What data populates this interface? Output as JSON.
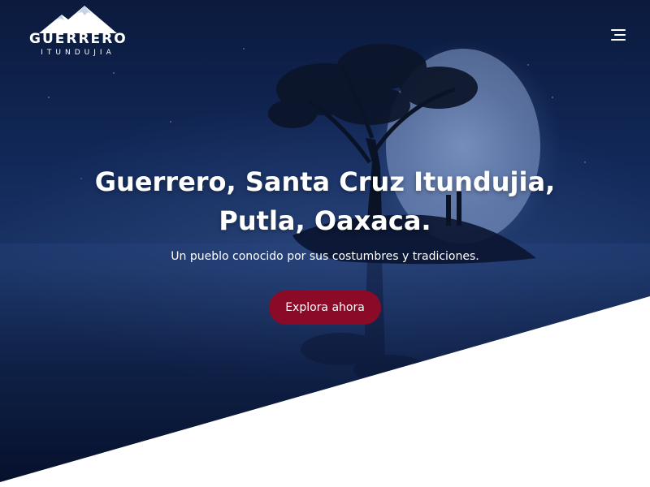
{
  "brand": {
    "title": "GUERRERO",
    "subtitle": "ITUNDUJIA"
  },
  "header": {
    "menu_icon": "hamburger-menu-icon"
  },
  "hero": {
    "headline": "Guerrero, Santa Cruz Itundujia, Putla, Oaxaca.",
    "subheadline": "Un pueblo conocido por sus costumbres y tradiciones.",
    "cta_label": "Explora ahora"
  },
  "colors": {
    "cta_background": "#8b0a27",
    "hero_dark_blue": "#0b1a3d",
    "text": "#ffffff"
  }
}
